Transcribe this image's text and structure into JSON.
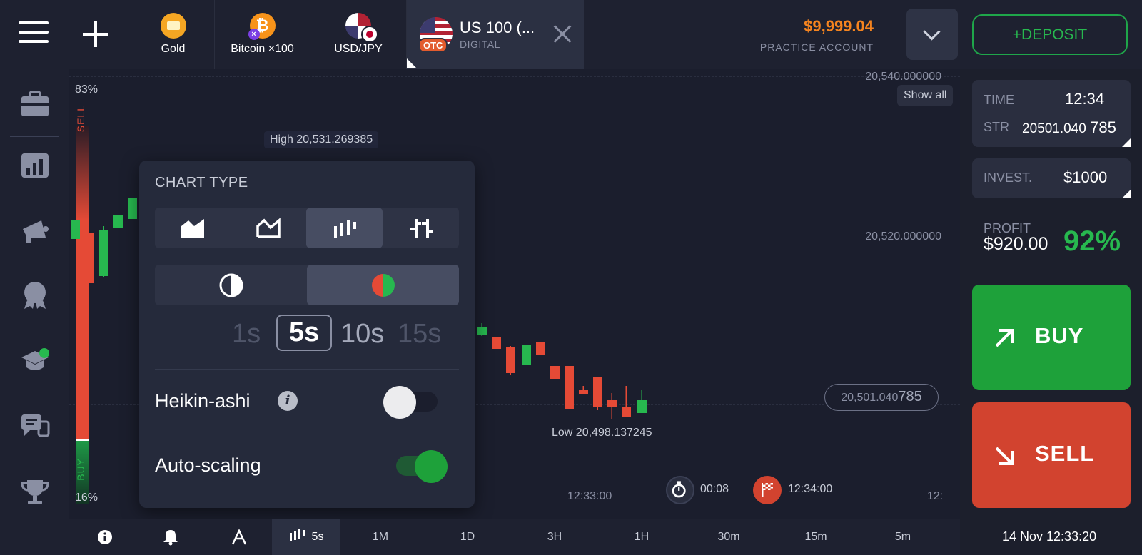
{
  "top": {
    "assets": [
      {
        "label": "Gold"
      },
      {
        "label": "Bitcoin ×100",
        "sub_badge": "×"
      },
      {
        "label": "USD/JPY"
      }
    ],
    "active_asset": {
      "title": "US 100 (...",
      "subtitle": "DIGITAL",
      "badge": "OTC"
    },
    "balance": "$9,999.04",
    "account_type": "PRACTICE ACCOUNT",
    "deposit_label": "+DEPOSIT"
  },
  "sidebar": {
    "icons": [
      "menu-icon",
      "add-icon",
      "portfolio-icon",
      "chart-stats-icon",
      "promo-megaphone-icon",
      "achievements-medal-icon",
      "education-cap-icon",
      "chat-support-icon",
      "leaderboard-trophy-icon"
    ]
  },
  "chart": {
    "show_all": "Show all",
    "price_labels": [
      "20,540.000000",
      "20,520.000000"
    ],
    "sentiment": {
      "sell_pct": "83%",
      "buy_pct": "16%",
      "sell_label": "SELL",
      "buy_label": "BUY"
    },
    "high_label": "High 20,531.269385",
    "low_label": "Low 20,498.137245",
    "current_price_main": "20,501.040",
    "current_price_tail": "785",
    "timer_text": "00:08",
    "expiry_text": "12:34:00",
    "time_ticks": [
      "12:33:00",
      "12:"
    ],
    "colors": {
      "up": "#27b84f",
      "down": "#e54a36"
    }
  },
  "popup": {
    "title": "CHART TYPE",
    "chart_types": [
      "area-chart-icon",
      "line-chart-icon",
      "candlestick-chart-icon",
      "bar-chart-icon"
    ],
    "active_chart_type": "candlestick-chart-icon",
    "color_modes": [
      "monochrome-icon",
      "red-green-icon"
    ],
    "timeframes": [
      "1s",
      "5s",
      "10s",
      "15s"
    ],
    "selected_timeframe": "5s",
    "heikin_ashi": {
      "label": "Heikin-ashi",
      "on": false
    },
    "auto_scaling": {
      "label": "Auto-scaling",
      "on": true
    }
  },
  "right_panel": {
    "time_label": "TIME",
    "time_value": "12:34",
    "str_label": "STR",
    "str_main": "20501.040",
    "str_tail": "785",
    "invest_label": "INVEST.",
    "invest_value": "$1000",
    "profit_label": "PROFIT",
    "profit_value": "$920.00",
    "profit_pct": "92%",
    "buy_label": "BUY",
    "sell_label": "SELL"
  },
  "bottom": {
    "candle_period": "5s",
    "periods": [
      "1M",
      "1D",
      "3H",
      "1H",
      "30m",
      "15m",
      "5m"
    ],
    "datetime": "14 Nov 12:33:20"
  }
}
